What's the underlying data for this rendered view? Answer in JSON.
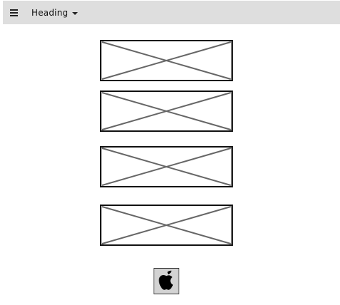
{
  "topbar": {
    "menu_icon": "hamburger-menu-icon",
    "heading_label": "Heading",
    "dropdown_icon": "caret-down-icon",
    "background_color": "#dedede"
  },
  "main": {
    "placeholders": [
      {
        "name": "image-placeholder-1",
        "icon": "image-placeholder-icon"
      },
      {
        "name": "image-placeholder-2",
        "icon": "image-placeholder-icon"
      },
      {
        "name": "image-placeholder-3",
        "icon": "image-placeholder-icon"
      },
      {
        "name": "image-placeholder-4",
        "icon": "image-placeholder-icon"
      }
    ],
    "footer_logo": {
      "icon": "apple-logo-icon",
      "background_color": "#d3d3d3"
    }
  }
}
